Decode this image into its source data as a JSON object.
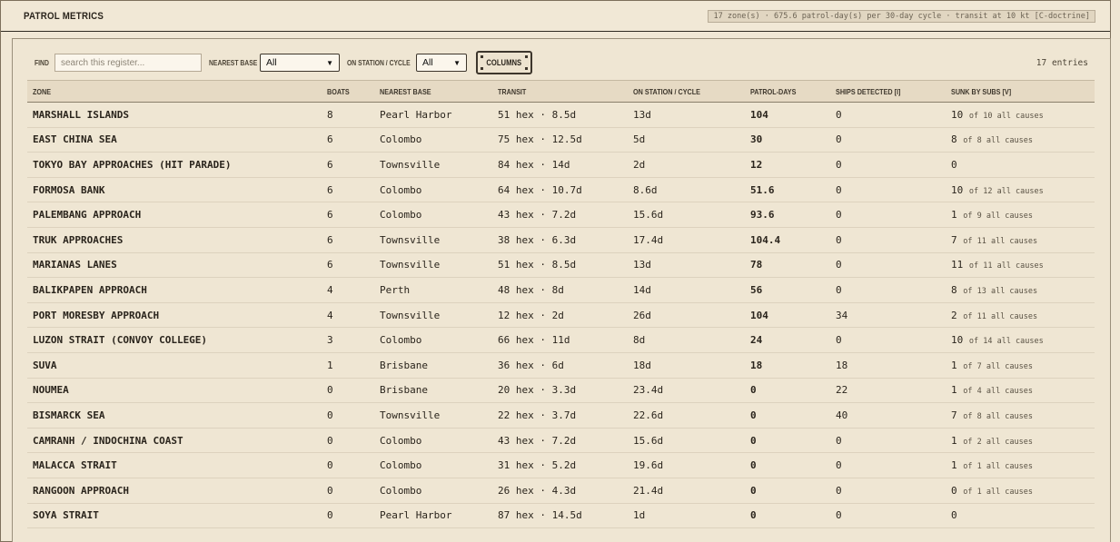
{
  "header": {
    "title": "PATROL METRICS",
    "summary": "17 zone(s) · 675.6 patrol-day(s) per 30-day cycle · transit at 10 kt [C-doctrine]"
  },
  "controls": {
    "find_label": "FIND",
    "search_placeholder": "search this register...",
    "search_value": "",
    "base_label": "NEAREST BASE",
    "base_value": "All",
    "cycle_label": "ON STATION / CYCLE",
    "cycle_value": "All",
    "columns_label": "COLUMNS",
    "entries": "17 entries"
  },
  "table": {
    "columns": [
      "ZONE",
      "BOATS",
      "NEAREST BASE",
      "TRANSIT",
      "ON STATION / CYCLE",
      "PATROL-DAYS",
      "SHIPS DETECTED [I]",
      "SUNK BY SUBS [V]"
    ],
    "rows": [
      {
        "zone": "MARSHALL ISLANDS",
        "boats": "8",
        "base": "Pearl Harbor",
        "transit": "51 hex · 8.5d",
        "onstation": "13d",
        "pd": "104",
        "detected": "0",
        "sunk": "10",
        "sunk_of": "of 10 all causes"
      },
      {
        "zone": "EAST CHINA SEA",
        "boats": "6",
        "base": "Colombo",
        "transit": "75 hex · 12.5d",
        "onstation": "5d",
        "pd": "30",
        "detected": "0",
        "sunk": "8",
        "sunk_of": "of 8 all causes"
      },
      {
        "zone": "TOKYO BAY APPROACHES (HIT PARADE)",
        "boats": "6",
        "base": "Townsville",
        "transit": "84 hex · 14d",
        "onstation": "2d",
        "pd": "12",
        "detected": "0",
        "sunk": "0",
        "sunk_of": ""
      },
      {
        "zone": "FORMOSA BANK",
        "boats": "6",
        "base": "Colombo",
        "transit": "64 hex · 10.7d",
        "onstation": "8.6d",
        "pd": "51.6",
        "detected": "0",
        "sunk": "10",
        "sunk_of": "of 12 all causes"
      },
      {
        "zone": "PALEMBANG APPROACH",
        "boats": "6",
        "base": "Colombo",
        "transit": "43 hex · 7.2d",
        "onstation": "15.6d",
        "pd": "93.6",
        "detected": "0",
        "sunk": "1",
        "sunk_of": "of 9 all causes"
      },
      {
        "zone": "TRUK APPROACHES",
        "boats": "6",
        "base": "Townsville",
        "transit": "38 hex · 6.3d",
        "onstation": "17.4d",
        "pd": "104.4",
        "detected": "0",
        "sunk": "7",
        "sunk_of": "of 11 all causes"
      },
      {
        "zone": "MARIANAS LANES",
        "boats": "6",
        "base": "Townsville",
        "transit": "51 hex · 8.5d",
        "onstation": "13d",
        "pd": "78",
        "detected": "0",
        "sunk": "11",
        "sunk_of": "of 11 all causes"
      },
      {
        "zone": "BALIKPAPEN APPROACH",
        "boats": "4",
        "base": "Perth",
        "transit": "48 hex · 8d",
        "onstation": "14d",
        "pd": "56",
        "detected": "0",
        "sunk": "8",
        "sunk_of": "of 13 all causes"
      },
      {
        "zone": "PORT MORESBY APPROACH",
        "boats": "4",
        "base": "Townsville",
        "transit": "12 hex · 2d",
        "onstation": "26d",
        "pd": "104",
        "detected": "34",
        "sunk": "2",
        "sunk_of": "of 11 all causes"
      },
      {
        "zone": "LUZON STRAIT (CONVOY COLLEGE)",
        "boats": "3",
        "base": "Colombo",
        "transit": "66 hex · 11d",
        "onstation": "8d",
        "pd": "24",
        "detected": "0",
        "sunk": "10",
        "sunk_of": "of 14 all causes"
      },
      {
        "zone": "SUVA",
        "boats": "1",
        "base": "Brisbane",
        "transit": "36 hex · 6d",
        "onstation": "18d",
        "pd": "18",
        "detected": "18",
        "sunk": "1",
        "sunk_of": "of 7 all causes"
      },
      {
        "zone": "NOUMEA",
        "boats": "0",
        "base": "Brisbane",
        "transit": "20 hex · 3.3d",
        "onstation": "23.4d",
        "pd": "0",
        "detected": "22",
        "sunk": "1",
        "sunk_of": "of 4 all causes"
      },
      {
        "zone": "BISMARCK SEA",
        "boats": "0",
        "base": "Townsville",
        "transit": "22 hex · 3.7d",
        "onstation": "22.6d",
        "pd": "0",
        "detected": "40",
        "sunk": "7",
        "sunk_of": "of 8 all causes"
      },
      {
        "zone": "CAMRANH / INDOCHINA COAST",
        "boats": "0",
        "base": "Colombo",
        "transit": "43 hex · 7.2d",
        "onstation": "15.6d",
        "pd": "0",
        "detected": "0",
        "sunk": "1",
        "sunk_of": "of 2 all causes"
      },
      {
        "zone": "MALACCA STRAIT",
        "boats": "0",
        "base": "Colombo",
        "transit": "31 hex · 5.2d",
        "onstation": "19.6d",
        "pd": "0",
        "detected": "0",
        "sunk": "1",
        "sunk_of": "of 1 all causes"
      },
      {
        "zone": "RANGOON APPROACH",
        "boats": "0",
        "base": "Colombo",
        "transit": "26 hex · 4.3d",
        "onstation": "21.4d",
        "pd": "0",
        "detected": "0",
        "sunk": "0",
        "sunk_of": "of 1 all causes"
      },
      {
        "zone": "SOYA STRAIT",
        "boats": "0",
        "base": "Pearl Harbor",
        "transit": "87 hex · 14.5d",
        "onstation": "1d",
        "pd": "0",
        "detected": "0",
        "sunk": "0",
        "sunk_of": ""
      }
    ]
  }
}
